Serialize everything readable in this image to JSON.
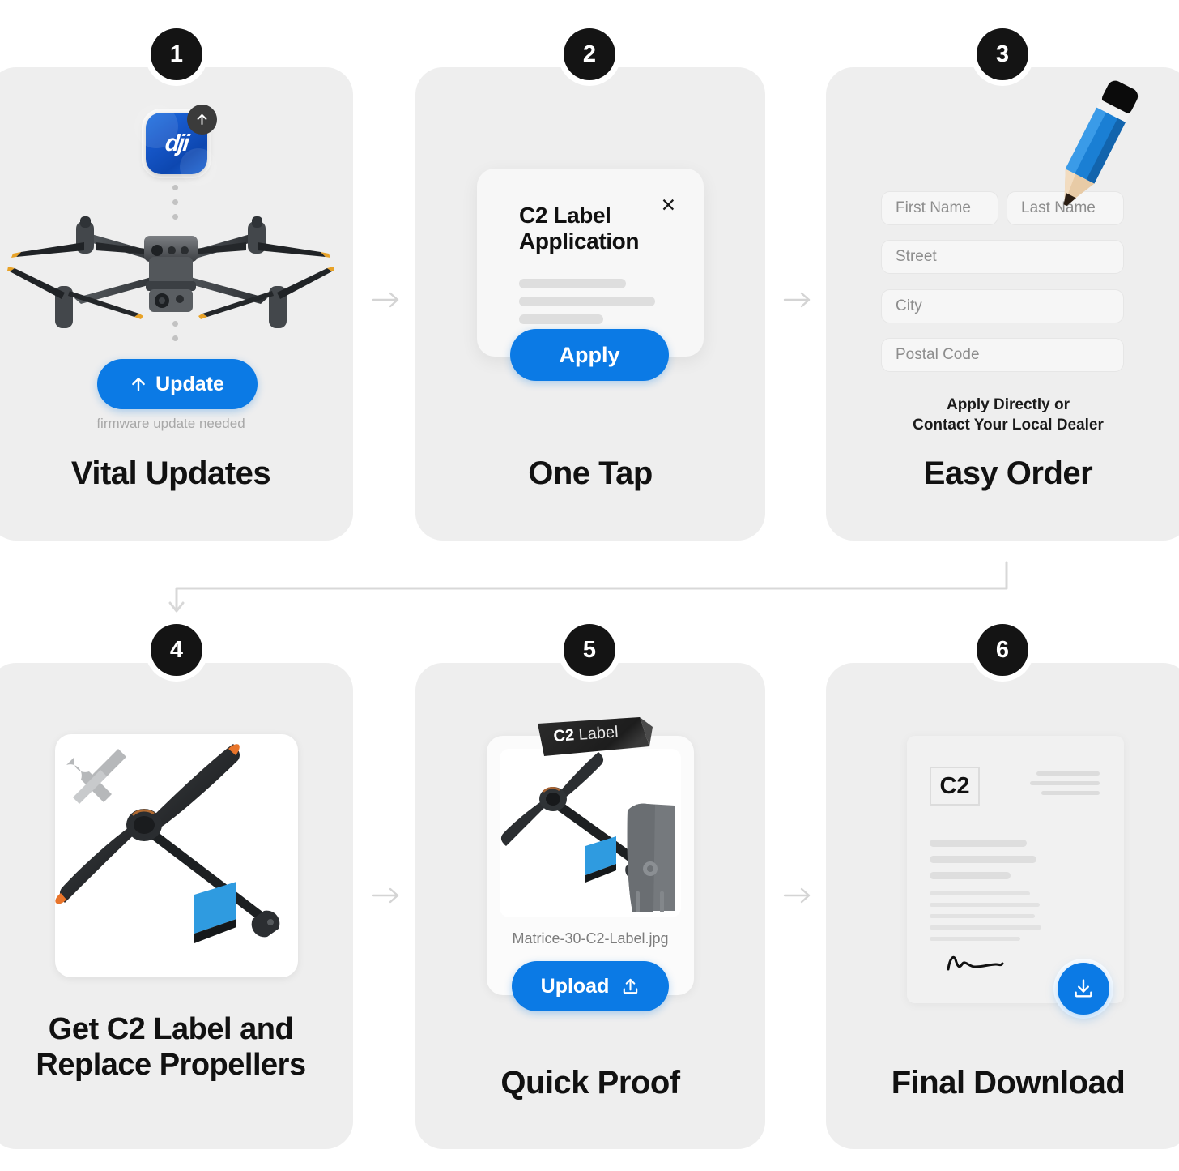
{
  "theme": {
    "accent_blue": "#0b7ae5",
    "card_bg": "#eeeeee",
    "badge_bg": "#141414",
    "page_bg": "#ffffff",
    "muted_text": "#a8a8a8"
  },
  "steps": [
    {
      "number": "1",
      "title": "Vital Updates",
      "app_icon_label": "dji",
      "update_badge_icon": "upload-arrow-icon",
      "button_label": "Update",
      "button_icon": "up-arrow-icon",
      "hint": "firmware update needed",
      "image_alt": "DJI Matrice 30 drone"
    },
    {
      "number": "2",
      "title": "One Tap",
      "modal": {
        "heading_line1": "C2 Label",
        "heading_line2": "Application",
        "close_icon": "close-icon",
        "apply_label": "Apply"
      }
    },
    {
      "number": "3",
      "title": "Easy Order",
      "fields": [
        {
          "placeholder": "First Name"
        },
        {
          "placeholder": "Last Name"
        },
        {
          "placeholder": "Street"
        },
        {
          "placeholder": "City"
        },
        {
          "placeholder": "Postal Code"
        }
      ],
      "note_line1": "Apply Directly or",
      "note_line2": "Contact Your Local Dealer",
      "decor_icon": "pencil-icon"
    },
    {
      "number": "4",
      "title_line1": "Get C2 Label and",
      "title_line2": "Replace Propellers",
      "tools_icon": "tools-icon",
      "image_alt": "Propeller with blue C2 label sticker"
    },
    {
      "number": "5",
      "title": "Quick Proof",
      "tag_label_bold": "C2",
      "tag_label_rest": " Label",
      "filename": "Matrice-30-C2-Label.jpg",
      "upload_label": "Upload",
      "upload_icon": "upload-icon",
      "image_alt": "Propeller arm with C2 label close-up"
    },
    {
      "number": "6",
      "title": "Final Download",
      "doc_logo": "C2",
      "download_icon": "download-icon",
      "signature_alt": "handwritten signature"
    }
  ],
  "connectors": {
    "arrow_1_2": "arrow-right-icon",
    "arrow_2_3": "arrow-right-icon",
    "arrow_4_5": "arrow-right-icon",
    "arrow_5_6": "arrow-right-icon",
    "wrap_connector": "arrow-wrap-down-icon"
  }
}
